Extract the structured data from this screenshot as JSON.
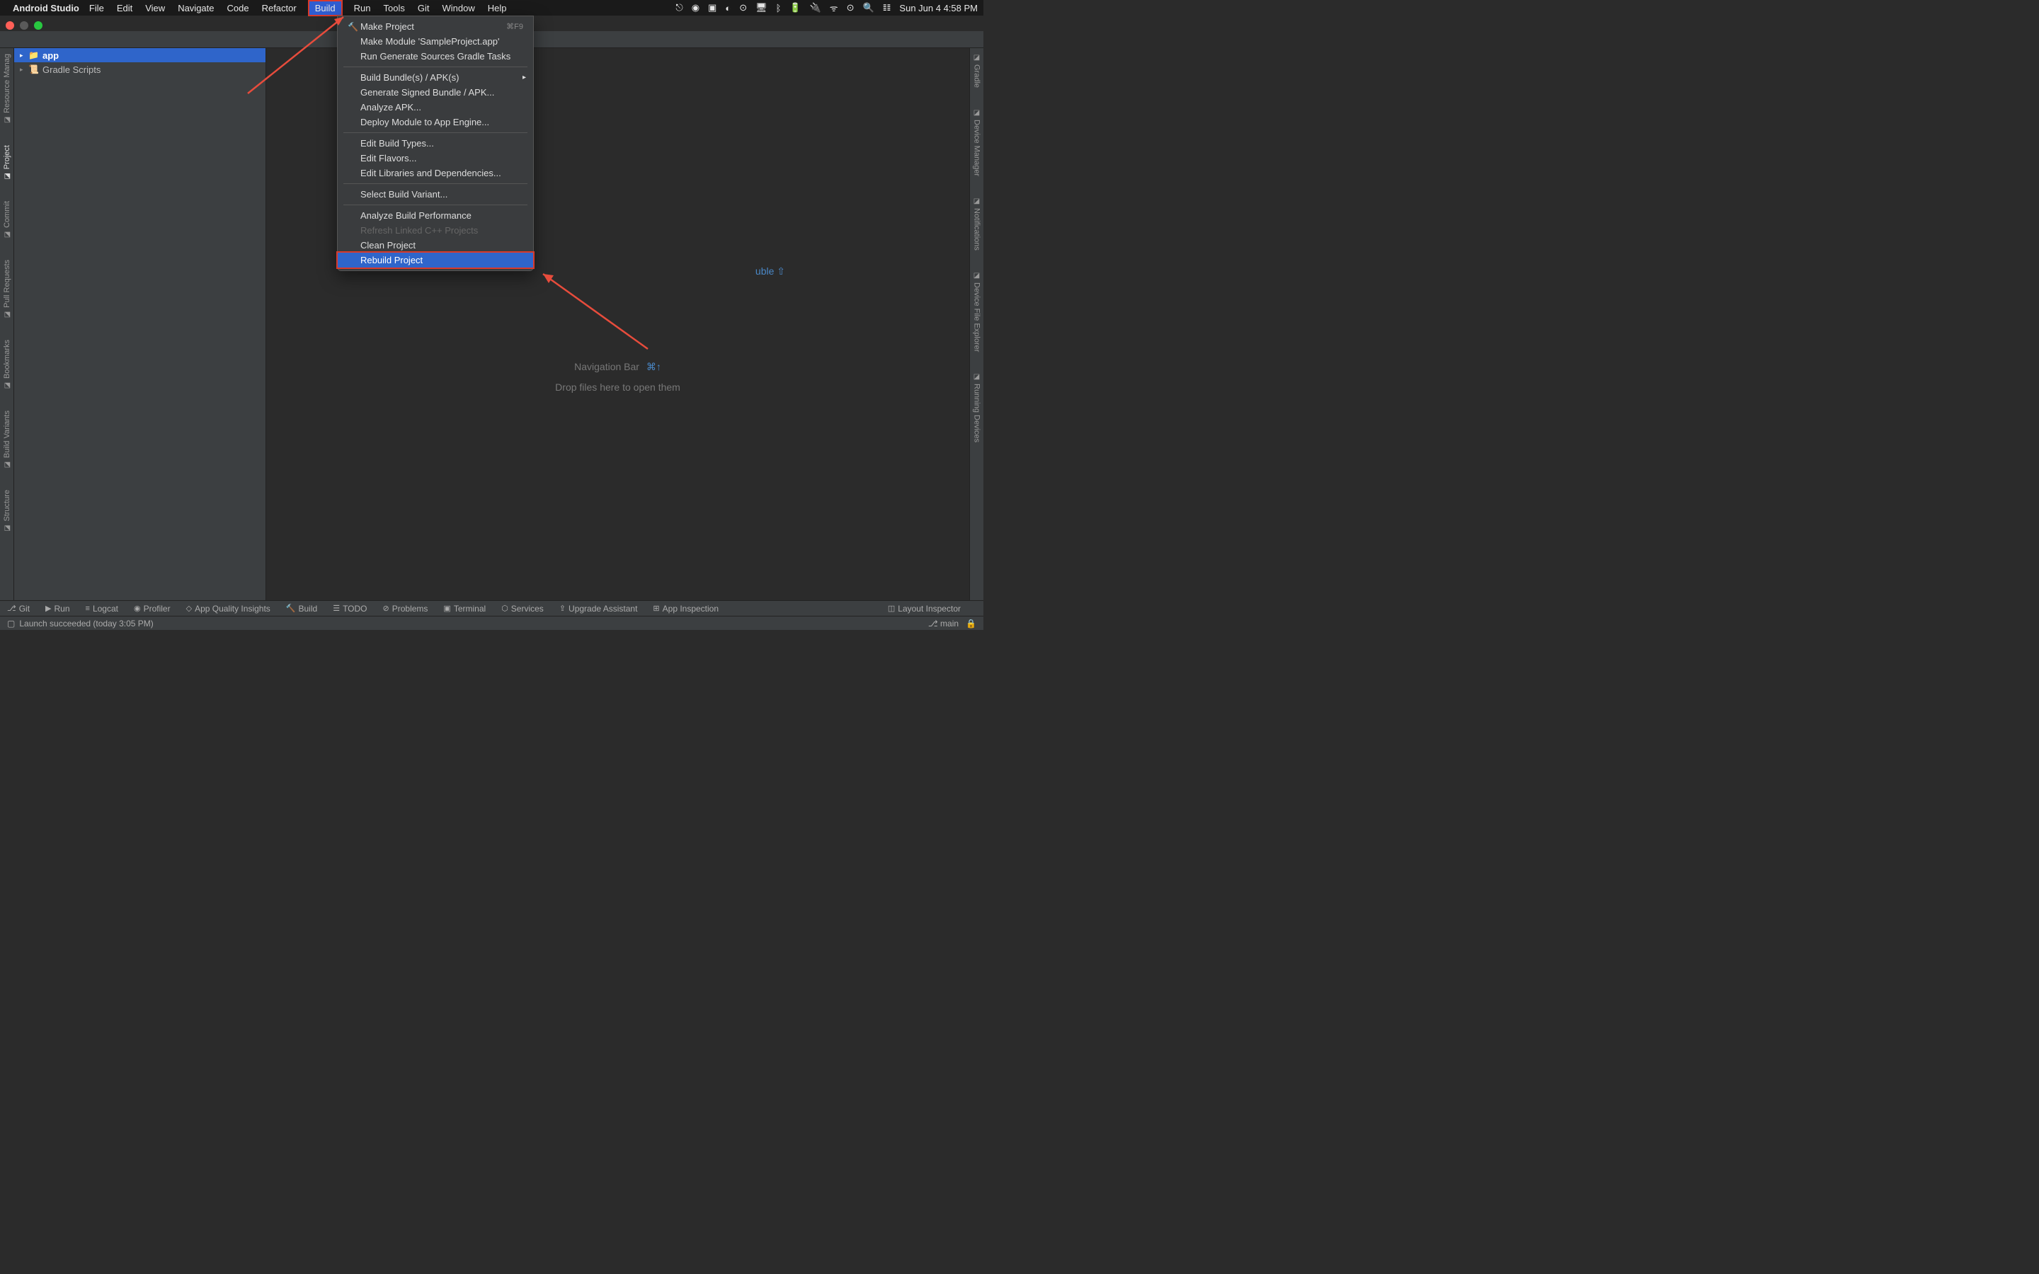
{
  "menubar": {
    "app_name": "Android Studio",
    "items": [
      "File",
      "Edit",
      "View",
      "Navigate",
      "Code",
      "Refactor",
      "Build",
      "Run",
      "Tools",
      "Git",
      "Window",
      "Help"
    ],
    "active_index": 6,
    "clock": "Sun Jun 4  4:58 PM"
  },
  "project_tree": {
    "items": [
      {
        "label": "app",
        "selected": true,
        "bold": true,
        "icon": "📁"
      },
      {
        "label": "Gradle Scripts",
        "selected": false,
        "bold": false,
        "icon": "📜"
      }
    ]
  },
  "left_tools": [
    "Resource Manag",
    "Project",
    "Commit",
    "Pull Requests",
    "Bookmarks",
    "Build Variants",
    "Structure"
  ],
  "left_tools_active": 1,
  "right_tools": [
    "Gradle",
    "Device Manager",
    "Notifications",
    "Device File Explorer",
    "Running Devices"
  ],
  "build_menu": {
    "groups": [
      [
        {
          "label": "Make Project",
          "icon": "🔨",
          "shortcut": "⌘F9"
        },
        {
          "label": "Make Module 'SampleProject.app'"
        },
        {
          "label": "Run Generate Sources Gradle Tasks"
        }
      ],
      [
        {
          "label": "Build Bundle(s) / APK(s)",
          "submenu": true
        },
        {
          "label": "Generate Signed Bundle / APK..."
        },
        {
          "label": "Analyze APK..."
        },
        {
          "label": "Deploy Module to App Engine..."
        }
      ],
      [
        {
          "label": "Edit Build Types..."
        },
        {
          "label": "Edit Flavors..."
        },
        {
          "label": "Edit Libraries and Dependencies..."
        }
      ],
      [
        {
          "label": "Select Build Variant..."
        }
      ],
      [
        {
          "label": "Analyze Build Performance"
        },
        {
          "label": "Refresh Linked C++ Projects",
          "disabled": true
        },
        {
          "label": "Clean Project"
        },
        {
          "label": "Rebuild Project",
          "highlighted": true
        }
      ]
    ]
  },
  "editor": {
    "peek_text": "uble ⇧",
    "nav_label": "Navigation Bar",
    "nav_shortcut": "⌘↑",
    "drop_text": "Drop files here to open them"
  },
  "bottom_tools": [
    {
      "icon": "⎇",
      "label": "Git"
    },
    {
      "icon": "▶",
      "label": "Run"
    },
    {
      "icon": "≡",
      "label": "Logcat"
    },
    {
      "icon": "◉",
      "label": "Profiler"
    },
    {
      "icon": "◇",
      "label": "App Quality Insights"
    },
    {
      "icon": "🔨",
      "label": "Build"
    },
    {
      "icon": "☰",
      "label": "TODO"
    },
    {
      "icon": "⊘",
      "label": "Problems"
    },
    {
      "icon": "▣",
      "label": "Terminal"
    },
    {
      "icon": "⬡",
      "label": "Services"
    },
    {
      "icon": "⇪",
      "label": "Upgrade Assistant"
    },
    {
      "icon": "⊞",
      "label": "App Inspection"
    }
  ],
  "bottom_right": {
    "icon": "◫",
    "label": "Layout Inspector"
  },
  "status": {
    "message": "Launch succeeded (today 3:05 PM)",
    "branch": "main"
  }
}
